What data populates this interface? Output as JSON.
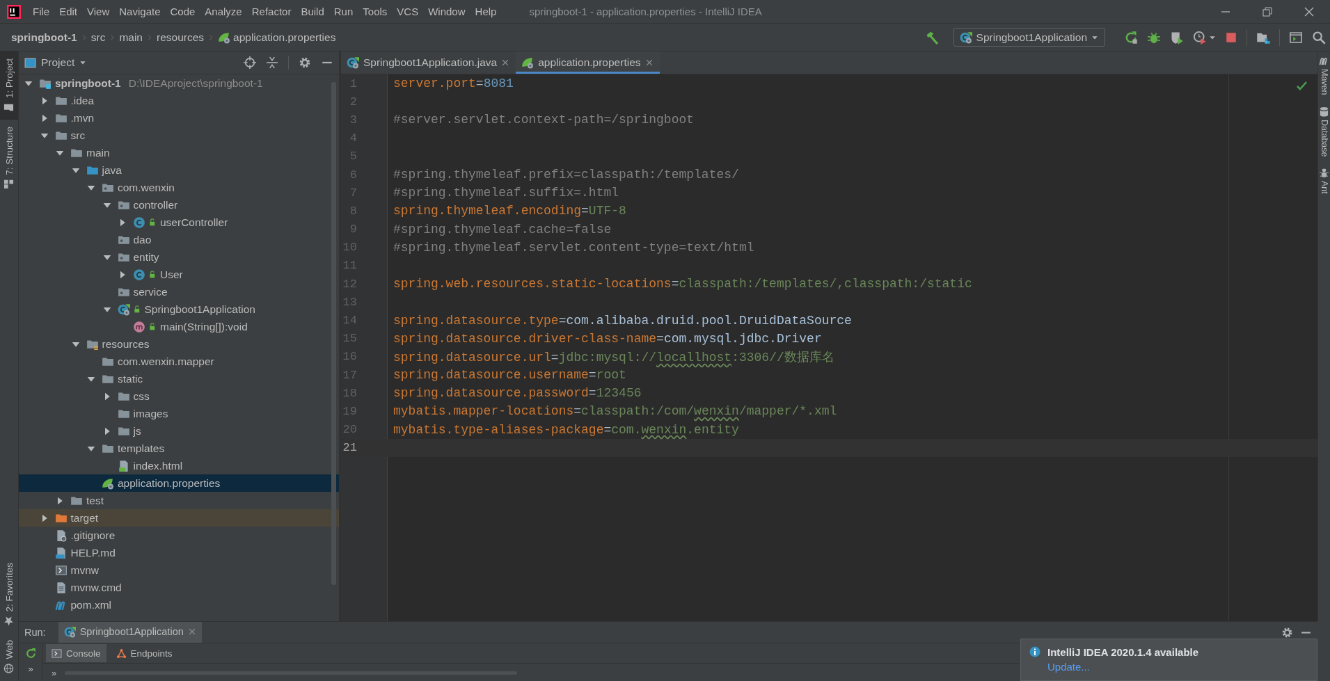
{
  "window": {
    "title": "springboot-1 - application.properties - IntelliJ IDEA"
  },
  "menu": [
    "File",
    "Edit",
    "View",
    "Navigate",
    "Code",
    "Analyze",
    "Refactor",
    "Build",
    "Run",
    "Tools",
    "VCS",
    "Window",
    "Help"
  ],
  "breadcrumbs": [
    {
      "label": "springboot-1",
      "kind": "project"
    },
    {
      "label": "src",
      "kind": "folder"
    },
    {
      "label": "main",
      "kind": "folder"
    },
    {
      "label": "resources",
      "kind": "folder"
    },
    {
      "label": "application.properties",
      "kind": "properties-file"
    }
  ],
  "toolbar": {
    "run_configuration": "Springboot1Application"
  },
  "left_strip": [
    {
      "label": "1: Project",
      "kind": "project",
      "selected": true
    },
    {
      "label": "7: Structure",
      "kind": "structure",
      "selected": false
    }
  ],
  "left_strip_bottom": [
    {
      "label": "2: Favorites",
      "kind": "favorites",
      "selected": false
    },
    {
      "label": "Web",
      "kind": "web",
      "selected": false
    }
  ],
  "right_strip": [
    {
      "label": "Maven",
      "kind": "maven"
    },
    {
      "label": "Database",
      "kind": "database"
    },
    {
      "label": "Ant",
      "kind": "ant"
    }
  ],
  "project": {
    "title": "Project",
    "tree": [
      {
        "label": "springboot-1",
        "hint": "D:\\IDEAproject\\springboot-1",
        "kind": "module",
        "expandable": true,
        "expanded": true,
        "selected": false,
        "children": [
          {
            "label": ".idea",
            "kind": "folder",
            "expandable": true,
            "expanded": false,
            "selected": false
          },
          {
            "label": ".mvn",
            "kind": "folder",
            "expandable": true,
            "expanded": false,
            "selected": false
          },
          {
            "label": "src",
            "kind": "folder",
            "expandable": true,
            "expanded": true,
            "selected": false,
            "children": [
              {
                "label": "main",
                "kind": "folder",
                "expandable": true,
                "expanded": true,
                "selected": false,
                "children": [
                  {
                    "label": "java",
                    "kind": "source-folder",
                    "expandable": true,
                    "expanded": true,
                    "selected": false,
                    "children": [
                      {
                        "label": "com.wenxin",
                        "kind": "package",
                        "expandable": true,
                        "expanded": true,
                        "selected": false,
                        "children": [
                          {
                            "label": "controller",
                            "kind": "package",
                            "expandable": true,
                            "expanded": true,
                            "selected": false,
                            "children": [
                              {
                                "label": "userController",
                                "kind": "class",
                                "expandable": true,
                                "expanded": false,
                                "selected": false
                              }
                            ]
                          },
                          {
                            "label": "dao",
                            "kind": "package",
                            "expandable": false,
                            "selected": false
                          },
                          {
                            "label": "entity",
                            "kind": "package",
                            "expandable": true,
                            "expanded": true,
                            "selected": false,
                            "children": [
                              {
                                "label": "User",
                                "kind": "class",
                                "expandable": true,
                                "expanded": false,
                                "selected": false
                              }
                            ]
                          },
                          {
                            "label": "service",
                            "kind": "package",
                            "expandable": false,
                            "selected": false
                          },
                          {
                            "label": "Springboot1Application",
                            "kind": "boot-class",
                            "expandable": true,
                            "expanded": true,
                            "selected": false,
                            "children": [
                              {
                                "label": "main(String[]):void",
                                "kind": "method",
                                "expandable": false,
                                "selected": false
                              }
                            ]
                          }
                        ]
                      }
                    ]
                  },
                  {
                    "label": "resources",
                    "kind": "resources-folder",
                    "expandable": true,
                    "expanded": true,
                    "selected": false,
                    "children": [
                      {
                        "label": "com.wenxin.mapper",
                        "kind": "folder",
                        "expandable": false,
                        "selected": false
                      },
                      {
                        "label": "static",
                        "kind": "folder",
                        "expandable": true,
                        "expanded": true,
                        "selected": false,
                        "children": [
                          {
                            "label": "css",
                            "kind": "folder",
                            "expandable": true,
                            "expanded": false,
                            "selected": false
                          },
                          {
                            "label": "images",
                            "kind": "folder",
                            "expandable": false,
                            "selected": false
                          },
                          {
                            "label": "js",
                            "kind": "folder",
                            "expandable": true,
                            "expanded": false,
                            "selected": false
                          }
                        ]
                      },
                      {
                        "label": "templates",
                        "kind": "folder",
                        "expandable": true,
                        "expanded": true,
                        "selected": false,
                        "children": [
                          {
                            "label": "index.html",
                            "kind": "html-file",
                            "expandable": false,
                            "selected": false
                          }
                        ]
                      },
                      {
                        "label": "application.properties",
                        "kind": "properties-file",
                        "expandable": false,
                        "selected": true
                      }
                    ]
                  }
                ]
              },
              {
                "label": "test",
                "kind": "folder",
                "expandable": true,
                "expanded": false,
                "selected": false
              }
            ]
          },
          {
            "label": "target",
            "kind": "excluded-folder",
            "expandable": true,
            "expanded": false,
            "selected": false
          },
          {
            "label": ".gitignore",
            "kind": "ignore-file",
            "expandable": false,
            "selected": false
          },
          {
            "label": "HELP.md",
            "kind": "markdown-file",
            "expandable": false,
            "selected": false
          },
          {
            "label": "mvnw",
            "kind": "shell-file",
            "expandable": false,
            "selected": false
          },
          {
            "label": "mvnw.cmd",
            "kind": "text-file",
            "expandable": false,
            "selected": false
          },
          {
            "label": "pom.xml",
            "kind": "maven-file",
            "expandable": false,
            "selected": false
          }
        ]
      }
    ]
  },
  "editor": {
    "tabs": [
      {
        "label": "Springboot1Application.java",
        "kind": "boot-class",
        "selected": false
      },
      {
        "label": "application.properties",
        "kind": "properties-file",
        "selected": true
      }
    ],
    "lines": [
      {
        "number": "1",
        "current": false,
        "segments": [
          {
            "text": "server.port",
            "kind": "key"
          },
          {
            "text": "=",
            "kind": "sep"
          },
          {
            "text": "8081",
            "kind": "number"
          }
        ]
      },
      {
        "number": "2",
        "current": false
      },
      {
        "number": "3",
        "current": false,
        "segments": [
          {
            "text": "#server.servlet.context-path=/springboot",
            "kind": "comment"
          }
        ]
      },
      {
        "number": "4",
        "current": false
      },
      {
        "number": "5",
        "current": false
      },
      {
        "number": "6",
        "current": false,
        "segments": [
          {
            "text": "#spring.thymeleaf.prefix=classpath:/templates/",
            "kind": "comment"
          }
        ]
      },
      {
        "number": "7",
        "current": false,
        "segments": [
          {
            "text": "#spring.thymeleaf.suffix=.html",
            "kind": "comment"
          }
        ]
      },
      {
        "number": "8",
        "current": false,
        "segments": [
          {
            "text": "spring.thymeleaf.encoding",
            "kind": "key"
          },
          {
            "text": "=",
            "kind": "sep"
          },
          {
            "text": "UTF-8",
            "kind": "string"
          }
        ]
      },
      {
        "number": "9",
        "current": false,
        "segments": [
          {
            "text": "#spring.thymeleaf.cache=false",
            "kind": "comment"
          }
        ]
      },
      {
        "number": "10",
        "current": false,
        "segments": [
          {
            "text": "#spring.thymeleaf.servlet.content-type=text/html",
            "kind": "comment"
          }
        ]
      },
      {
        "number": "11",
        "current": false
      },
      {
        "number": "12",
        "current": false,
        "segments": [
          {
            "text": "spring.web.resources.static-locations",
            "kind": "key"
          },
          {
            "text": "=",
            "kind": "sep"
          },
          {
            "text": "classpath:/templates/,classpath:/static",
            "kind": "string"
          }
        ]
      },
      {
        "number": "13",
        "current": false
      },
      {
        "number": "14",
        "current": false,
        "segments": [
          {
            "text": "spring.datasource.type",
            "kind": "key"
          },
          {
            "text": "=",
            "kind": "sep"
          },
          {
            "text": "com.alibaba.druid.pool.DruidDataSource",
            "kind": "ref"
          }
        ]
      },
      {
        "number": "15",
        "current": false,
        "segments": [
          {
            "text": "spring.datasource.driver-class-name",
            "kind": "key"
          },
          {
            "text": "=",
            "kind": "sep"
          },
          {
            "text": "com.mysql.jdbc.Driver",
            "kind": "ref"
          }
        ]
      },
      {
        "number": "16",
        "current": false,
        "segments": [
          {
            "text": "spring.datasource.url",
            "kind": "key"
          },
          {
            "text": "=",
            "kind": "sep"
          },
          {
            "text": "jdbc:mysql://",
            "kind": "string"
          },
          {
            "text": "locallhost",
            "kind": "misspelled"
          },
          {
            "text": ":3306//数据库名",
            "kind": "string"
          }
        ]
      },
      {
        "number": "17",
        "current": false,
        "segments": [
          {
            "text": "spring.datasource.username",
            "kind": "key"
          },
          {
            "text": "=",
            "kind": "sep"
          },
          {
            "text": "root",
            "kind": "string"
          }
        ]
      },
      {
        "number": "18",
        "current": false,
        "segments": [
          {
            "text": "spring.datasource.password",
            "kind": "key"
          },
          {
            "text": "=",
            "kind": "sep"
          },
          {
            "text": "123456",
            "kind": "string"
          }
        ]
      },
      {
        "number": "19",
        "current": false,
        "segments": [
          {
            "text": "mybatis.mapper-locations",
            "kind": "key"
          },
          {
            "text": "=",
            "kind": "sep"
          },
          {
            "text": "classpath:/com/",
            "kind": "string"
          },
          {
            "text": "wenxin",
            "kind": "misspelled"
          },
          {
            "text": "/mapper/*.xml",
            "kind": "string"
          }
        ]
      },
      {
        "number": "20",
        "current": false,
        "segments": [
          {
            "text": "mybatis.type-aliases-package",
            "kind": "key"
          },
          {
            "text": "=",
            "kind": "sep"
          },
          {
            "text": "com.",
            "kind": "string"
          },
          {
            "text": "wenxin",
            "kind": "misspelled"
          },
          {
            "text": ".entity",
            "kind": "string"
          }
        ]
      },
      {
        "number": "21",
        "current": true
      }
    ]
  },
  "run": {
    "label": "Run:",
    "tabs": [
      {
        "label": "Springboot1Application",
        "selected": true
      }
    ],
    "subtabs": [
      {
        "label": "Console",
        "kind": "console",
        "selected": true
      },
      {
        "label": "Endpoints",
        "kind": "endpoints",
        "selected": false
      }
    ],
    "overflow": [
      "»",
      "»"
    ]
  },
  "notification": {
    "title": "IntelliJ IDEA 2020.1.4 available",
    "link": "Update..."
  }
}
